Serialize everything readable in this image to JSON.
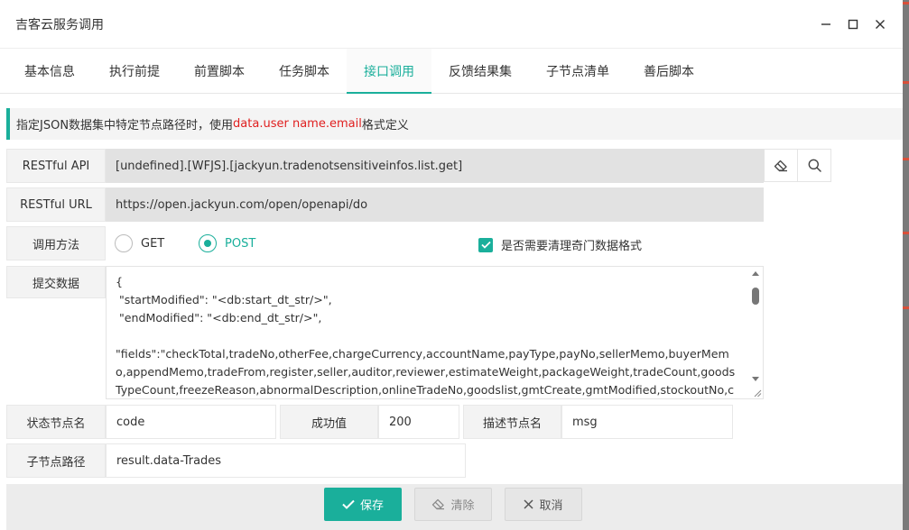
{
  "window": {
    "title": "吉客云服务调用"
  },
  "tabs": [
    {
      "label": "基本信息"
    },
    {
      "label": "执行前提"
    },
    {
      "label": "前置脚本"
    },
    {
      "label": "任务脚本"
    },
    {
      "label": "接口调用",
      "active": true
    },
    {
      "label": "反馈结果集"
    },
    {
      "label": "子节点清单"
    },
    {
      "label": "善后脚本"
    }
  ],
  "tip": {
    "prefix": "指定JSON数据集中特定节点路径时，使用",
    "highlight": "data.user name.email",
    "suffix": "格式定义"
  },
  "form": {
    "api_label": "RESTful API",
    "api_value": "[undefined].[WFJS].[jackyun.tradenotsensitiveinfos.list.get]",
    "url_label": "RESTful URL",
    "url_value": "https://open.jackyun.com/open/openapi/do",
    "method_label": "调用方法",
    "method_get": "GET",
    "method_post": "POST",
    "selected_method": "POST",
    "clean_format_label": "是否需要清理奇门数据格式",
    "clean_format_checked": true,
    "body_label": "提交数据",
    "body_value": "{\n \"startModified\": \"<db:start_dt_str/>\",\n \"endModified\": \"<db:end_dt_str/>\",\n\n\"fields\":\"checkTotal,tradeNo,otherFee,chargeCurrency,accountName,payType,payNo,sellerMemo,buyerMemo,appendMemo,tradeFrom,register,seller,auditor,reviewer,estimateWeight,packageWeight,tradeCount,goodsTypeCount,freezeReason,abnormalDescription,onlineTradeNo,goodslist,gmtCreate,gmtModified,stockoutNo,confirmTi",
    "status_label": "状态节点名",
    "status_value": "code",
    "success_label": "成功值",
    "success_value": "200",
    "desc_label": "描述节点名",
    "desc_value": "msg",
    "child_path_label": "子节点路径",
    "child_path_value": "result.data-Trades"
  },
  "icons": {
    "clear_api": "eraser-icon",
    "search_api": "search-icon"
  },
  "footer": {
    "save_label": "保存",
    "clear_label": "清除",
    "cancel_label": "取消"
  },
  "colors": {
    "accent": "#1aaf9b",
    "highlight": "#e02020"
  }
}
